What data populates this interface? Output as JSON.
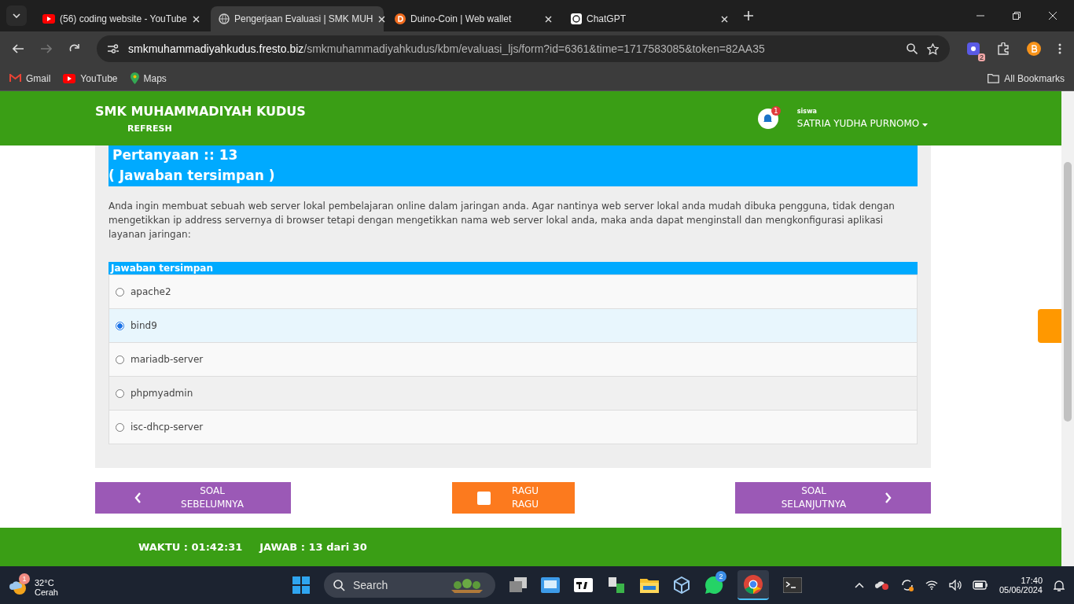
{
  "browser": {
    "tabs": [
      {
        "title": "(56) coding website - YouTube",
        "kind": "youtube",
        "selected": false
      },
      {
        "title": "Pengerjaan Evaluasi | SMK MUH",
        "kind": "globe",
        "selected": true
      },
      {
        "title": "Duino-Coin | Web wallet",
        "kind": "coin",
        "selected": false
      },
      {
        "title": "ChatGPT",
        "kind": "chat",
        "selected": false
      }
    ],
    "url_domain": "smkmuhammadiyahkudus.fresto.biz",
    "url_path": "/smkmuhammadiyahkudus/kbm/evaluasi_ljs/form?id=6361&time=1717583085&token=82AA35",
    "extension_badge": "2",
    "bookmarks": [
      {
        "label": "Gmail",
        "kind": "gmail"
      },
      {
        "label": "YouTube",
        "kind": "youtube"
      },
      {
        "label": "Maps",
        "kind": "maps"
      }
    ],
    "all_bookmarks": "All Bookmarks"
  },
  "page": {
    "school_name": "SMK MUHAMMADIYAH KUDUS",
    "refresh": "REFRESH",
    "notification_count": "1",
    "user_role": "siswa",
    "user_name": "SATRIA YUDHA PURNOMO",
    "question_title": "Pertanyaan :: 13",
    "saved_status": "( Jawaban tersimpan )",
    "question_text": "Anda ingin membuat sebuah web server lokal pembelajaran online dalam jaringan anda. Agar nantinya web server lokal anda mudah dibuka pengguna, tidak dengan mengetikkan ip address servernya di browser tetapi dengan mengetikkan nama web server lokal anda, maka anda dapat menginstall dan mengkonfigurasi aplikasi layanan jaringan:",
    "answers_header": "Jawaban tersimpan",
    "options": [
      {
        "label": "apache2",
        "selected": false
      },
      {
        "label": "bind9",
        "selected": true
      },
      {
        "label": "mariadb-server",
        "selected": false
      },
      {
        "label": "phpmyadmin",
        "selected": false
      },
      {
        "label": "isc-dhcp-server",
        "selected": false
      }
    ],
    "prev_button": "SOAL SEBELUMNYA",
    "doubt": {
      "label": "RAGU RAGU",
      "checked": false
    },
    "next_button": "SOAL SELANJUTNYA",
    "time_left": "WAKTU : 01:42:31",
    "answered": "JAWAB : 13 dari 30"
  },
  "taskbar": {
    "weather_badge": "1",
    "temperature": "32°C",
    "condition": "Cerah",
    "search_placeholder": "Search",
    "whatsapp_badge": "2",
    "time": "17:40",
    "date": "05/06/2024"
  }
}
